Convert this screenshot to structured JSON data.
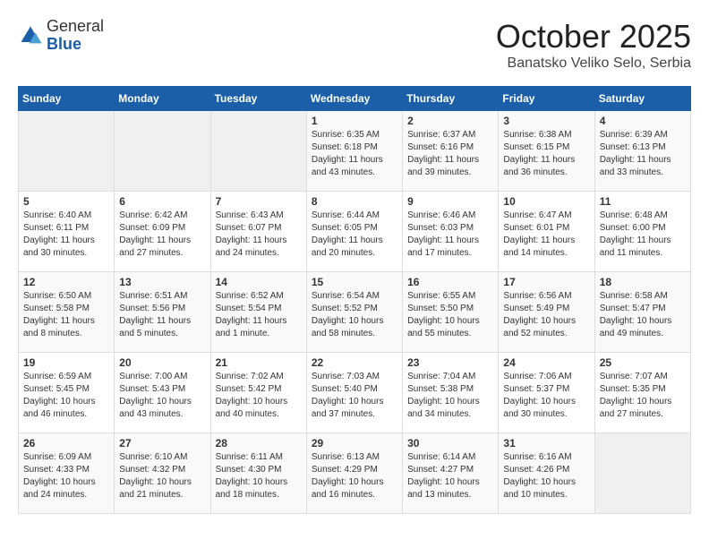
{
  "logo": {
    "general": "General",
    "blue": "Blue"
  },
  "header": {
    "month": "October 2025",
    "location": "Banatsko Veliko Selo, Serbia"
  },
  "days_of_week": [
    "Sunday",
    "Monday",
    "Tuesday",
    "Wednesday",
    "Thursday",
    "Friday",
    "Saturday"
  ],
  "weeks": [
    [
      {
        "day": "",
        "content": ""
      },
      {
        "day": "",
        "content": ""
      },
      {
        "day": "",
        "content": ""
      },
      {
        "day": "1",
        "content": "Sunrise: 6:35 AM\nSunset: 6:18 PM\nDaylight: 11 hours\nand 43 minutes."
      },
      {
        "day": "2",
        "content": "Sunrise: 6:37 AM\nSunset: 6:16 PM\nDaylight: 11 hours\nand 39 minutes."
      },
      {
        "day": "3",
        "content": "Sunrise: 6:38 AM\nSunset: 6:15 PM\nDaylight: 11 hours\nand 36 minutes."
      },
      {
        "day": "4",
        "content": "Sunrise: 6:39 AM\nSunset: 6:13 PM\nDaylight: 11 hours\nand 33 minutes."
      }
    ],
    [
      {
        "day": "5",
        "content": "Sunrise: 6:40 AM\nSunset: 6:11 PM\nDaylight: 11 hours\nand 30 minutes."
      },
      {
        "day": "6",
        "content": "Sunrise: 6:42 AM\nSunset: 6:09 PM\nDaylight: 11 hours\nand 27 minutes."
      },
      {
        "day": "7",
        "content": "Sunrise: 6:43 AM\nSunset: 6:07 PM\nDaylight: 11 hours\nand 24 minutes."
      },
      {
        "day": "8",
        "content": "Sunrise: 6:44 AM\nSunset: 6:05 PM\nDaylight: 11 hours\nand 20 minutes."
      },
      {
        "day": "9",
        "content": "Sunrise: 6:46 AM\nSunset: 6:03 PM\nDaylight: 11 hours\nand 17 minutes."
      },
      {
        "day": "10",
        "content": "Sunrise: 6:47 AM\nSunset: 6:01 PM\nDaylight: 11 hours\nand 14 minutes."
      },
      {
        "day": "11",
        "content": "Sunrise: 6:48 AM\nSunset: 6:00 PM\nDaylight: 11 hours\nand 11 minutes."
      }
    ],
    [
      {
        "day": "12",
        "content": "Sunrise: 6:50 AM\nSunset: 5:58 PM\nDaylight: 11 hours\nand 8 minutes."
      },
      {
        "day": "13",
        "content": "Sunrise: 6:51 AM\nSunset: 5:56 PM\nDaylight: 11 hours\nand 5 minutes."
      },
      {
        "day": "14",
        "content": "Sunrise: 6:52 AM\nSunset: 5:54 PM\nDaylight: 11 hours\nand 1 minute."
      },
      {
        "day": "15",
        "content": "Sunrise: 6:54 AM\nSunset: 5:52 PM\nDaylight: 10 hours\nand 58 minutes."
      },
      {
        "day": "16",
        "content": "Sunrise: 6:55 AM\nSunset: 5:50 PM\nDaylight: 10 hours\nand 55 minutes."
      },
      {
        "day": "17",
        "content": "Sunrise: 6:56 AM\nSunset: 5:49 PM\nDaylight: 10 hours\nand 52 minutes."
      },
      {
        "day": "18",
        "content": "Sunrise: 6:58 AM\nSunset: 5:47 PM\nDaylight: 10 hours\nand 49 minutes."
      }
    ],
    [
      {
        "day": "19",
        "content": "Sunrise: 6:59 AM\nSunset: 5:45 PM\nDaylight: 10 hours\nand 46 minutes."
      },
      {
        "day": "20",
        "content": "Sunrise: 7:00 AM\nSunset: 5:43 PM\nDaylight: 10 hours\nand 43 minutes."
      },
      {
        "day": "21",
        "content": "Sunrise: 7:02 AM\nSunset: 5:42 PM\nDaylight: 10 hours\nand 40 minutes."
      },
      {
        "day": "22",
        "content": "Sunrise: 7:03 AM\nSunset: 5:40 PM\nDaylight: 10 hours\nand 37 minutes."
      },
      {
        "day": "23",
        "content": "Sunrise: 7:04 AM\nSunset: 5:38 PM\nDaylight: 10 hours\nand 34 minutes."
      },
      {
        "day": "24",
        "content": "Sunrise: 7:06 AM\nSunset: 5:37 PM\nDaylight: 10 hours\nand 30 minutes."
      },
      {
        "day": "25",
        "content": "Sunrise: 7:07 AM\nSunset: 5:35 PM\nDaylight: 10 hours\nand 27 minutes."
      }
    ],
    [
      {
        "day": "26",
        "content": "Sunrise: 6:09 AM\nSunset: 4:33 PM\nDaylight: 10 hours\nand 24 minutes."
      },
      {
        "day": "27",
        "content": "Sunrise: 6:10 AM\nSunset: 4:32 PM\nDaylight: 10 hours\nand 21 minutes."
      },
      {
        "day": "28",
        "content": "Sunrise: 6:11 AM\nSunset: 4:30 PM\nDaylight: 10 hours\nand 18 minutes."
      },
      {
        "day": "29",
        "content": "Sunrise: 6:13 AM\nSunset: 4:29 PM\nDaylight: 10 hours\nand 16 minutes."
      },
      {
        "day": "30",
        "content": "Sunrise: 6:14 AM\nSunset: 4:27 PM\nDaylight: 10 hours\nand 13 minutes."
      },
      {
        "day": "31",
        "content": "Sunrise: 6:16 AM\nSunset: 4:26 PM\nDaylight: 10 hours\nand 10 minutes."
      },
      {
        "day": "",
        "content": ""
      }
    ]
  ]
}
